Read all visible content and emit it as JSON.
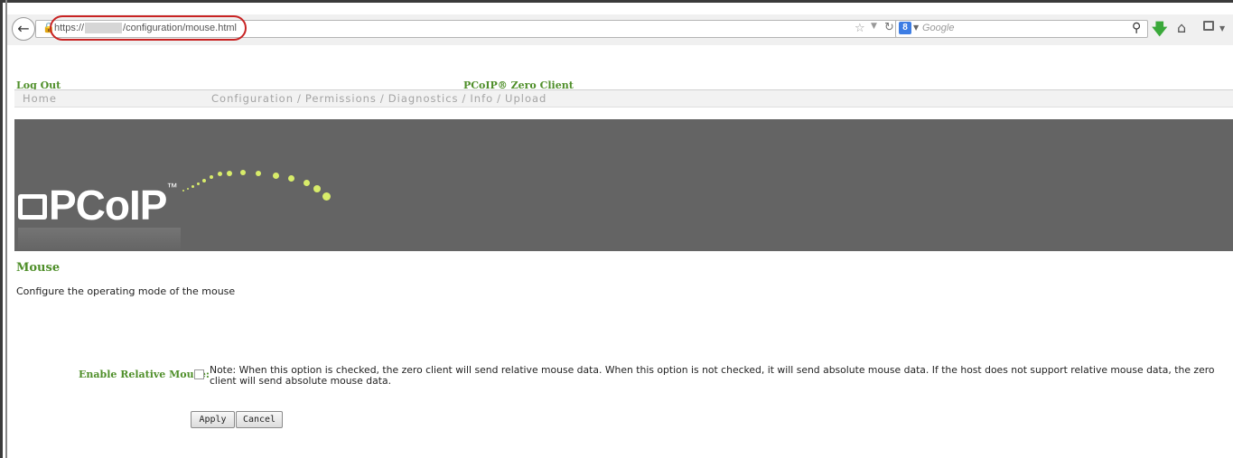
{
  "browser": {
    "url_prefix": "https://",
    "url_path": "/configuration/mouse.html",
    "search_placeholder": "Google",
    "search_engine_letter": "8"
  },
  "header": {
    "logout": "Log Out",
    "product": "PCoIP® Zero Client"
  },
  "nav": {
    "home": "Home",
    "items": [
      "Configuration",
      "Permissions",
      "Diagnostics",
      "Info",
      "Upload"
    ],
    "separator": "/"
  },
  "banner": {
    "logo": "PCoIP",
    "trademark": "™"
  },
  "page": {
    "title": "Mouse",
    "description": "Configure the operating mode of the mouse"
  },
  "form": {
    "relative_mouse_label": "Enable Relative Mouse:",
    "relative_mouse_checked": false,
    "note": "Note: When this option is checked, the zero client will send relative mouse data. When this option is not checked, it will send absolute mouse data. If the host does not support relative mouse data, the zero client will send absolute mouse data.",
    "apply": "Apply",
    "cancel": "Cancel"
  },
  "colors": {
    "accent_green": "#4f8f2a",
    "banner_gray": "#646464",
    "highlight_red": "#c82323"
  }
}
